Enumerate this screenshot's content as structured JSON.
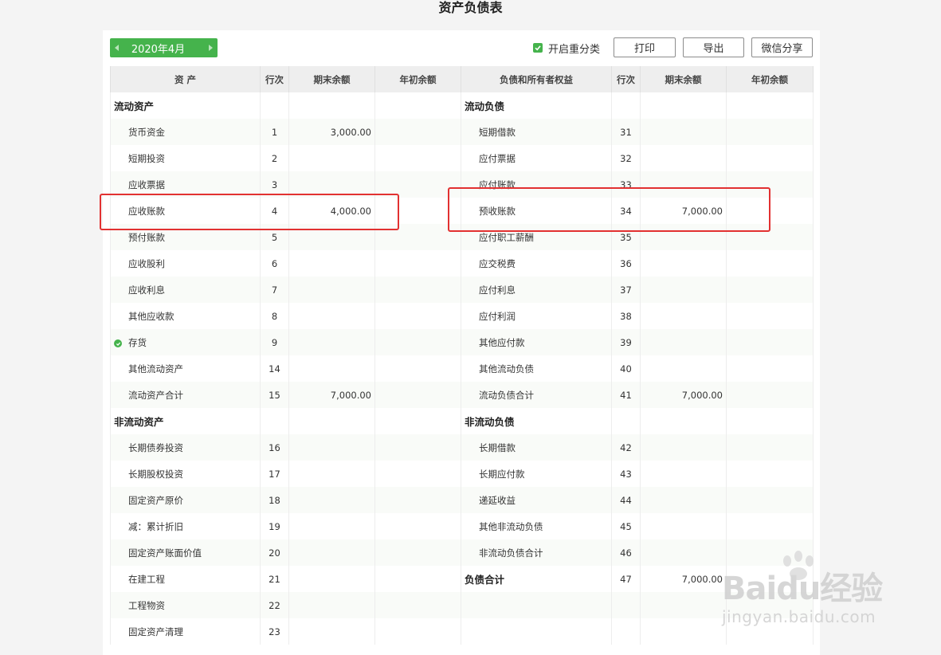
{
  "title": "资产负债表",
  "date_picker": {
    "value": "2020年4月"
  },
  "toolbar": {
    "reclass_label": "开启重分类",
    "reclass_checked": true,
    "print_label": "打印",
    "export_label": "导出",
    "wechat_label": "微信分享"
  },
  "colors": {
    "accent": "#45b34c",
    "highlight": "#e23131"
  },
  "table": {
    "headers": [
      "资 产",
      "行次",
      "期末余额",
      "年初余额",
      "负债和所有者权益",
      "行次",
      "期末余额",
      "年初余额"
    ],
    "rows": [
      {
        "a_name": "流动资产",
        "a_section": true,
        "a_line": "",
        "a_end": "",
        "a_begin": "",
        "l_name": "流动负债",
        "l_section": true,
        "l_line": "",
        "l_end": "",
        "l_begin": ""
      },
      {
        "a_name": "货币资金",
        "a_line": "1",
        "a_end": "3,000.00",
        "a_begin": "",
        "l_name": "短期借款",
        "l_line": "31",
        "l_end": "",
        "l_begin": ""
      },
      {
        "a_name": "短期投资",
        "a_line": "2",
        "a_end": "",
        "a_begin": "",
        "l_name": "应付票据",
        "l_line": "32",
        "l_end": "",
        "l_begin": ""
      },
      {
        "a_name": "应收票据",
        "a_line": "3",
        "a_end": "",
        "a_begin": "",
        "l_name": "应付账款",
        "l_line": "33",
        "l_end": "",
        "l_begin": ""
      },
      {
        "a_name": "应收账款",
        "a_line": "4",
        "a_end": "4,000.00",
        "a_begin": "",
        "l_name": "预收账款",
        "l_line": "34",
        "l_end": "7,000.00",
        "l_begin": ""
      },
      {
        "a_name": "预付账款",
        "a_line": "5",
        "a_end": "",
        "a_begin": "",
        "l_name": "应付职工薪酬",
        "l_line": "35",
        "l_end": "",
        "l_begin": ""
      },
      {
        "a_name": "应收股利",
        "a_line": "6",
        "a_end": "",
        "a_begin": "",
        "l_name": "应交税费",
        "l_line": "36",
        "l_end": "",
        "l_begin": ""
      },
      {
        "a_name": "应收利息",
        "a_line": "7",
        "a_end": "",
        "a_begin": "",
        "l_name": "应付利息",
        "l_line": "37",
        "l_end": "",
        "l_begin": ""
      },
      {
        "a_name": "其他应收款",
        "a_line": "8",
        "a_end": "",
        "a_begin": "",
        "l_name": "应付利润",
        "l_line": "38",
        "l_end": "",
        "l_begin": ""
      },
      {
        "a_name": "存货",
        "a_icon": "check-circle-icon",
        "a_line": "9",
        "a_end": "",
        "a_begin": "",
        "l_name": "其他应付款",
        "l_line": "39",
        "l_end": "",
        "l_begin": ""
      },
      {
        "a_name": "其他流动资产",
        "a_line": "14",
        "a_end": "",
        "a_begin": "",
        "l_name": "其他流动负债",
        "l_line": "40",
        "l_end": "",
        "l_begin": ""
      },
      {
        "a_name": "流动资产合计",
        "a_line": "15",
        "a_end": "7,000.00",
        "a_begin": "",
        "l_name": "流动负债合计",
        "l_line": "41",
        "l_end": "7,000.00",
        "l_begin": ""
      },
      {
        "a_name": "非流动资产",
        "a_section": true,
        "a_line": "",
        "a_end": "",
        "a_begin": "",
        "l_name": "非流动负债",
        "l_section": true,
        "l_line": "",
        "l_end": "",
        "l_begin": ""
      },
      {
        "a_name": "长期债券投资",
        "a_line": "16",
        "a_end": "",
        "a_begin": "",
        "l_name": "长期借款",
        "l_line": "42",
        "l_end": "",
        "l_begin": ""
      },
      {
        "a_name": "长期股权投资",
        "a_line": "17",
        "a_end": "",
        "a_begin": "",
        "l_name": "长期应付款",
        "l_line": "43",
        "l_end": "",
        "l_begin": ""
      },
      {
        "a_name": "固定资产原价",
        "a_line": "18",
        "a_end": "",
        "a_begin": "",
        "l_name": "递延收益",
        "l_line": "44",
        "l_end": "",
        "l_begin": ""
      },
      {
        "a_name": "减：累计折旧",
        "a_line": "19",
        "a_end": "",
        "a_begin": "",
        "l_name": "其他非流动负债",
        "l_line": "45",
        "l_end": "",
        "l_begin": ""
      },
      {
        "a_name": "固定资产账面价值",
        "a_line": "20",
        "a_end": "",
        "a_begin": "",
        "l_name": "非流动负债合计",
        "l_line": "46",
        "l_end": "",
        "l_begin": ""
      },
      {
        "a_name": "在建工程",
        "a_line": "21",
        "a_end": "",
        "a_begin": "",
        "l_name": "负债合计",
        "l_section": true,
        "l_line": "47",
        "l_end": "7,000.00",
        "l_begin": ""
      },
      {
        "a_name": "工程物资",
        "a_line": "22",
        "a_end": "",
        "a_begin": "",
        "l_name": "",
        "l_line": "",
        "l_end": "",
        "l_begin": ""
      },
      {
        "a_name": "固定资产清理",
        "a_line": "23",
        "a_end": "",
        "a_begin": "",
        "l_name": "",
        "l_line": "",
        "l_end": "",
        "l_begin": ""
      }
    ]
  },
  "watermark": {
    "main": "Baidu经验",
    "sub": "jingyan.baidu.com"
  }
}
